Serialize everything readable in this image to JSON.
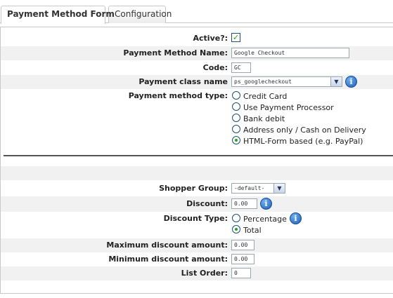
{
  "tabs": [
    {
      "label": "Payment Method Form"
    },
    {
      "label": "Configuration"
    }
  ],
  "form": {
    "active": {
      "label": "Active?:",
      "checked": true
    },
    "name": {
      "label": "Payment Method Name:",
      "value": "Google Checkout"
    },
    "code": {
      "label": "Code:",
      "value": "GC"
    },
    "class_name": {
      "label": "Payment class name",
      "value": "ps_googlecheckout"
    },
    "method_type": {
      "label": "Payment method type:",
      "options": [
        {
          "label": "Credit Card",
          "selected": false
        },
        {
          "label": "Use Payment Processor",
          "selected": false
        },
        {
          "label": "Bank debit",
          "selected": false
        },
        {
          "label": "Address only / Cash on Delivery",
          "selected": false
        },
        {
          "label": "HTML-Form based (e.g. PayPal)",
          "selected": true
        }
      ]
    },
    "shopper_group": {
      "label": "Shopper Group:",
      "value": "-default-"
    },
    "discount": {
      "label": "Discount:",
      "value": "0.00"
    },
    "discount_type": {
      "label": "Discount Type:",
      "options": [
        {
          "label": "Percentage",
          "selected": false
        },
        {
          "label": "Total",
          "selected": true
        }
      ]
    },
    "max_discount": {
      "label": "Maximum discount amount:",
      "value": "0.00"
    },
    "min_discount": {
      "label": "Minimum discount amount:",
      "value": "0.00"
    },
    "list_order": {
      "label": "List Order:",
      "value": "0"
    }
  },
  "icons": {
    "info": "i",
    "dropdown": "▼",
    "check": "✓"
  }
}
